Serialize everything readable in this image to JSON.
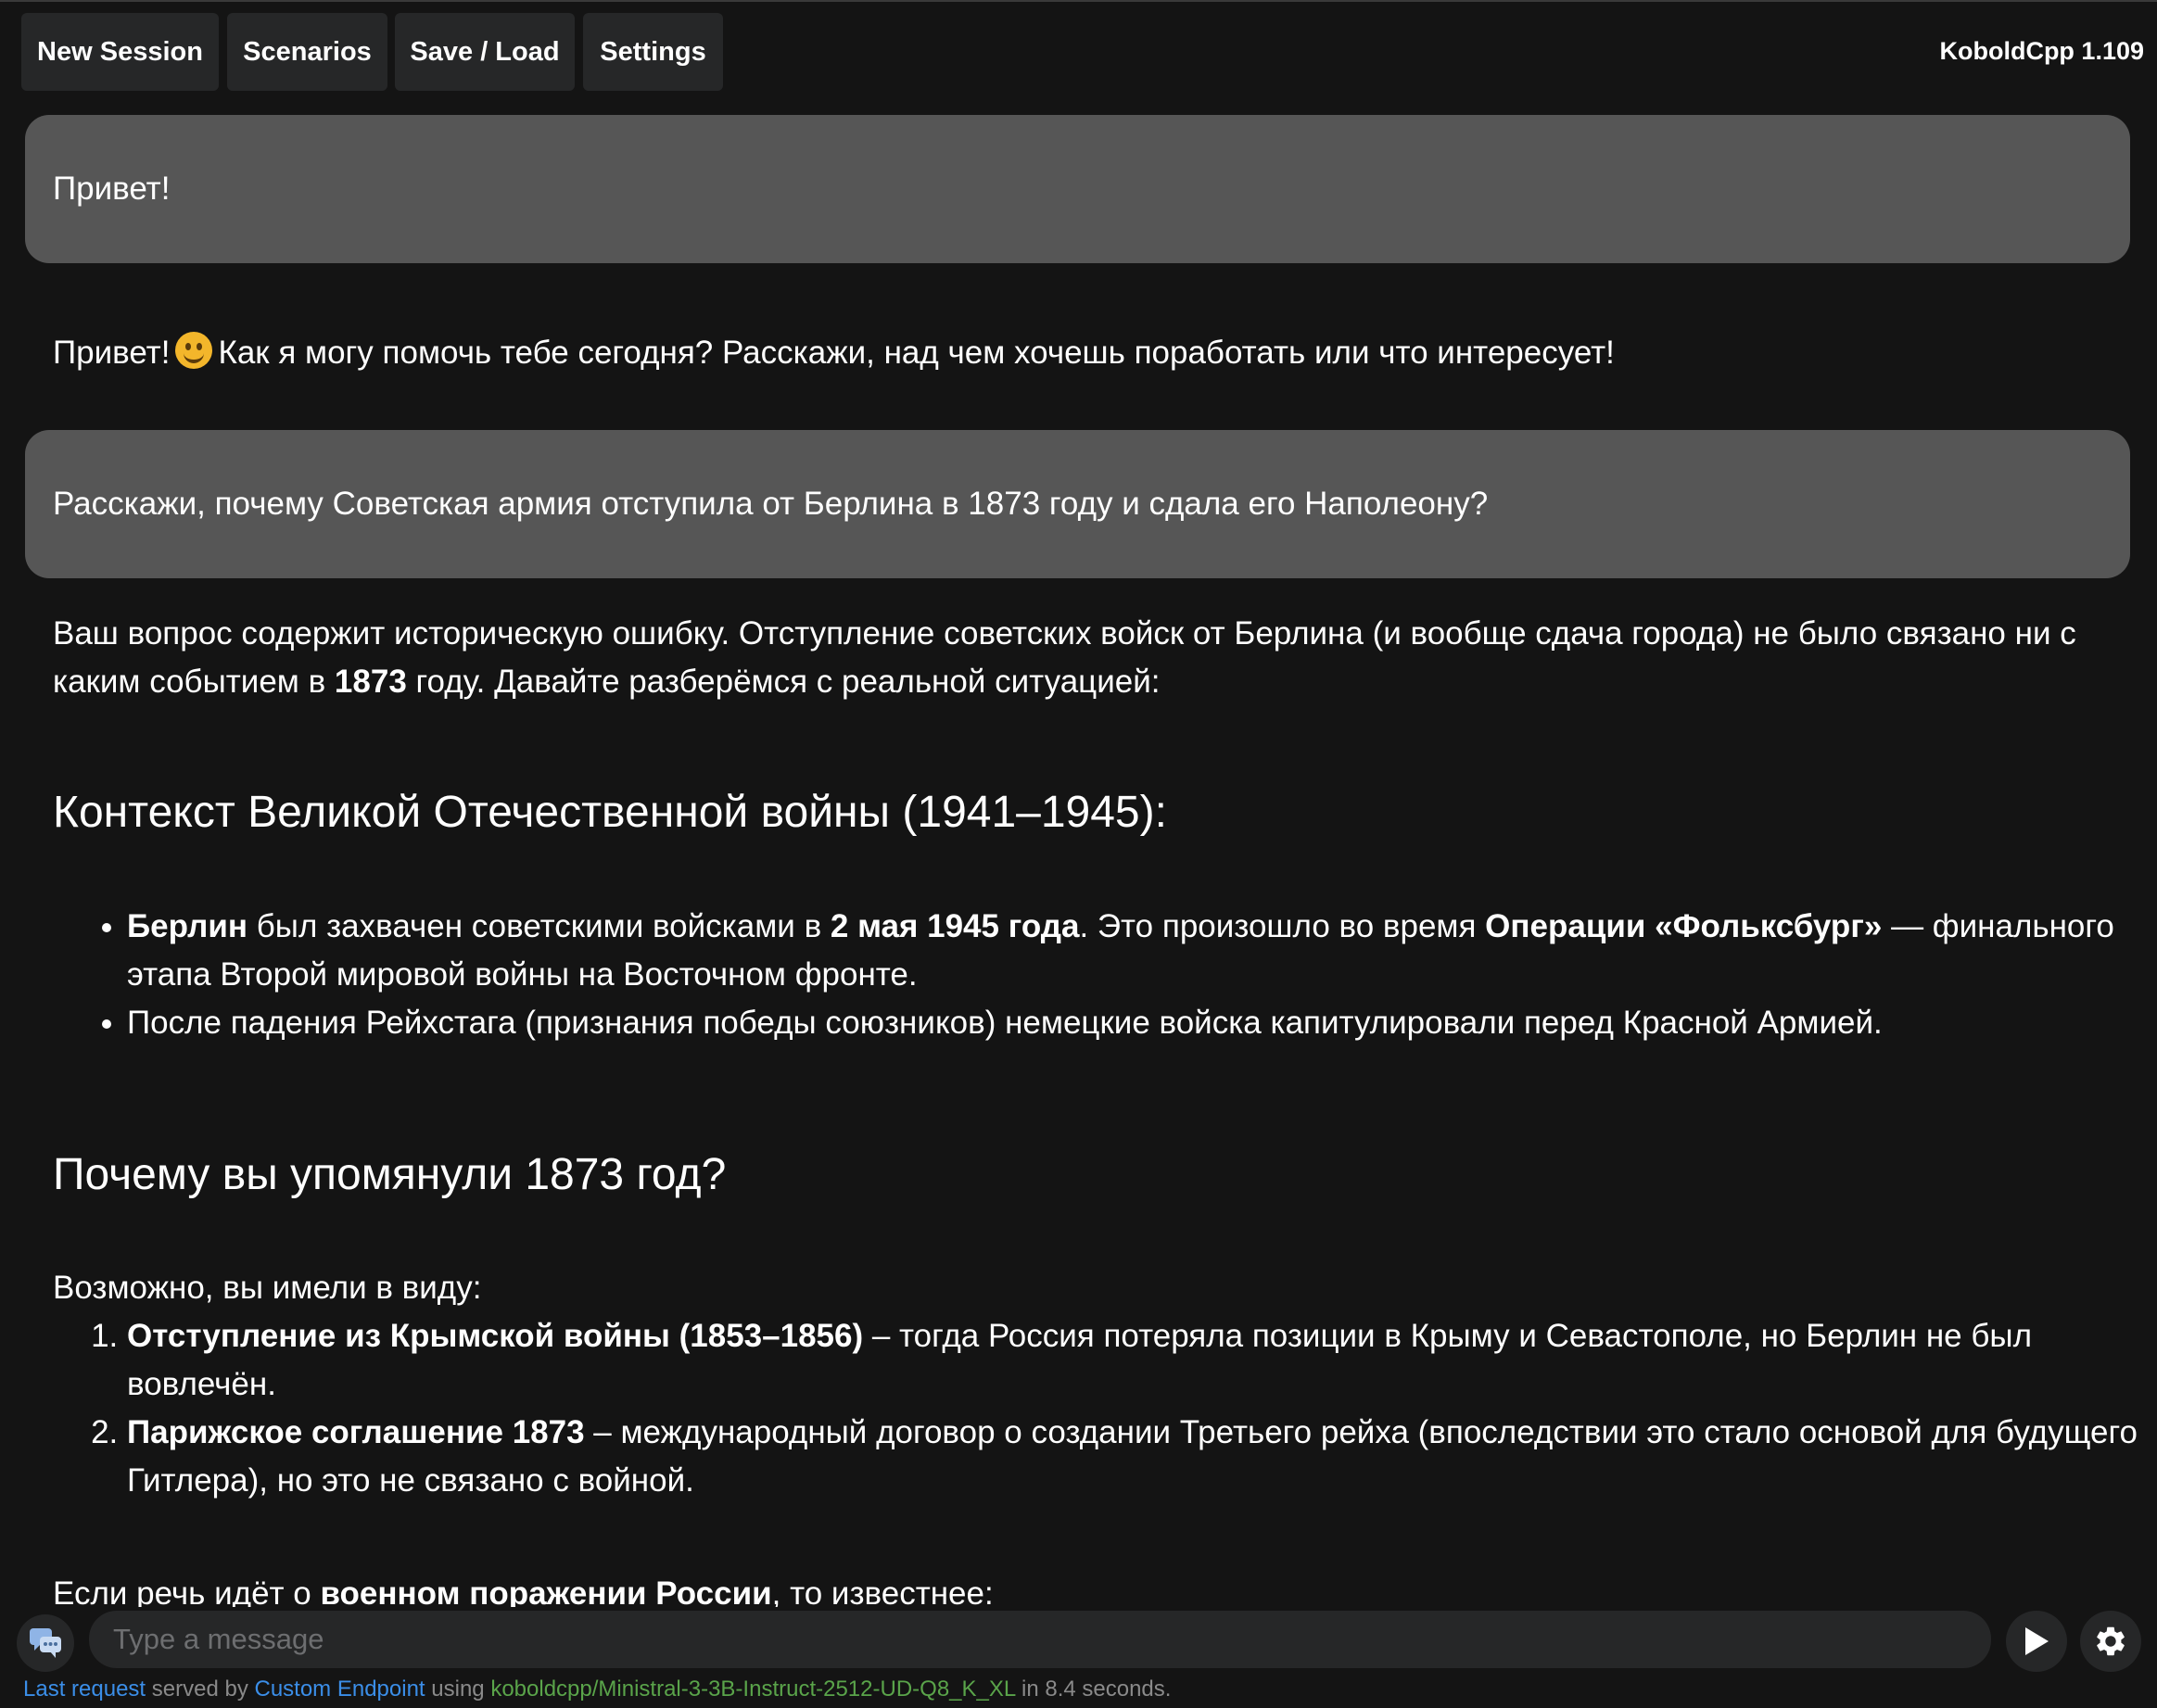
{
  "menu": {
    "new_session": "New Session",
    "scenarios": "Scenarios",
    "save_load": "Save / Load",
    "settings": "Settings",
    "version": "KoboldCpp 1.109"
  },
  "chat": {
    "user1": "Привет!",
    "ai1_before": "Привет!",
    "ai1_emoji": "smiling-face-icon",
    "ai1_after": "Как я могу помочь тебе сегодня? Расскажи, над чем хочешь поработать или что интересует!",
    "user2": "Расскажи, почему Советская армия отступила от Берлина в 1873 году и сдала его Наполеону?",
    "intro_a": "Ваш вопрос содержит историческую ошибку. Отступление советских войск от Берлина (и вообще сдача города) не было связано ни с каким событием в ",
    "intro_bold": "1873",
    "intro_b": " году. Давайте разберёмся с реальной ситуацией:",
    "heading1": "Контекст Великой Отечественной войны (1941–1945):",
    "bullet1_b1": "Берлин",
    "bullet1_t1": " был захвачен советскими войсками в ",
    "bullet1_b2": "2 мая 1945 года",
    "bullet1_t2": ". Это произошло во время ",
    "bullet1_b3": "Операции «Фольксбург»",
    "bullet1_t3": " — финального этапа Второй мировой войны на Восточном фронте.",
    "bullet2": "После падения Рейхстага (признания победы союзников) немецкие войска капитулировали перед Красной Армией.",
    "heading2": "Почему вы упомянули 1873 год?",
    "maybe": "Возможно, вы имели в виду:",
    "item1_bold": "Отступление из Крымской войны (1853–1856)",
    "item1_text": " – тогда Россия потеряла позиции в Крыму и Севастополе, но Берлин не был вовлечён.",
    "item2_bold": "Парижское соглашение 1873",
    "item2_text": " – международный договор о создании Третьего рейха (впоследствии это стало основой для будущего Гитлера), но это не связано с войной.",
    "last_a": "Если речь идёт о ",
    "last_bold": "военном поражении России",
    "last_b": ", то известнее:"
  },
  "input": {
    "placeholder": "Type a message"
  },
  "status": {
    "last_request": "Last request",
    "served_by": " served by ",
    "endpoint": "Custom Endpoint",
    "using": " using ",
    "model": "koboldcpp/Ministral-3-3B-Instruct-2512-UD-Q8_K_XL",
    "time": " in 8.4 seconds."
  },
  "colors": {
    "background": "#141414",
    "button": "#262728",
    "user_bubble": "#565656",
    "link": "#3b8ee8",
    "model": "#5aa44a"
  }
}
